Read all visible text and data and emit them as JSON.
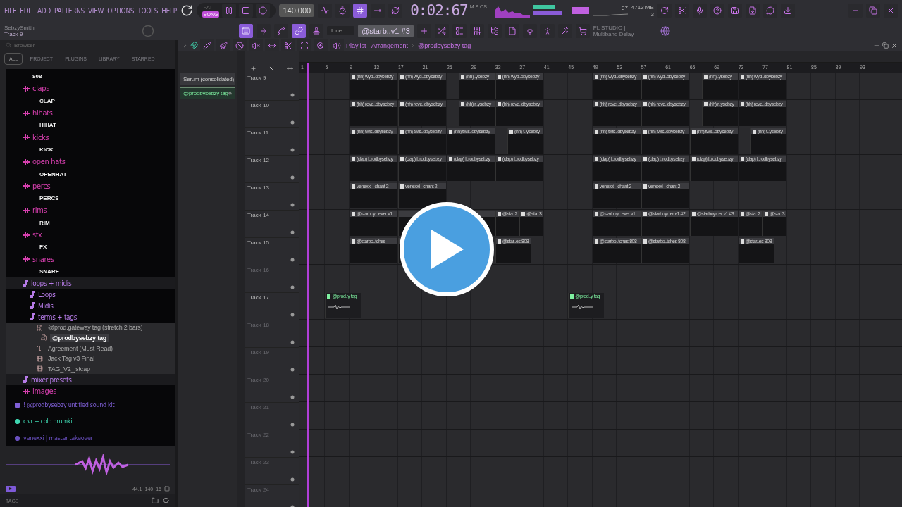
{
  "menu": [
    "FILE",
    "EDIT",
    "ADD",
    "PATTERNS",
    "VIEW",
    "OPTIONS",
    "TOOLS",
    "HELP"
  ],
  "transport": {
    "modes": [
      {
        "label": "PAT",
        "selected": false
      },
      {
        "label": "SONG",
        "selected": true
      }
    ],
    "tempo": "140.000",
    "time": "0:02:67",
    "time_format": "M:S:CS"
  },
  "toggles_top": [
    {
      "on": false
    },
    {
      "on": false
    },
    {
      "on": true
    },
    {
      "on": false
    },
    {
      "on": false
    }
  ],
  "monitor": {
    "cpu": "37",
    "memory": "4713 MB",
    "polyphony": "3"
  },
  "hint": {
    "title": "SebzySmith",
    "text": "Track 9"
  },
  "toggles_tools": [
    {
      "on": true
    },
    {
      "on": false
    },
    {
      "on": false
    },
    {
      "on": true
    },
    {
      "on": false
    }
  ],
  "snap": "Line",
  "pattern": "@starb..v1 #3",
  "news": {
    "title": "FL STUDIO |",
    "text": "Multiband Delay"
  },
  "browser": {
    "title": "Browser",
    "tabs": [
      {
        "label": "ALL",
        "selected": true
      },
      {
        "label": "PROJECT",
        "selected": false
      },
      {
        "label": "PLUGINS",
        "selected": false
      },
      {
        "label": "LIBRARY",
        "selected": false
      },
      {
        "label": "STARRED",
        "selected": false
      }
    ],
    "tree": [
      {
        "kind": "sample",
        "label": "808"
      },
      {
        "kind": "drums",
        "label": "claps",
        "color": "#d63fae",
        "children": [
          {
            "kind": "sample",
            "label": "CLAP"
          }
        ]
      },
      {
        "kind": "drums",
        "label": "hihats",
        "color": "#d63fae",
        "children": [
          {
            "kind": "sample",
            "label": "HIHAT"
          }
        ]
      },
      {
        "kind": "drums",
        "label": "kicks",
        "color": "#d63fae",
        "children": [
          {
            "kind": "sample",
            "label": "KICK"
          }
        ]
      },
      {
        "kind": "drums",
        "label": "open hats",
        "color": "#d63fae",
        "children": [
          {
            "kind": "sample",
            "label": "OPENHAT"
          }
        ]
      },
      {
        "kind": "drums",
        "label": "percs",
        "color": "#d63fae",
        "children": [
          {
            "kind": "sample",
            "label": "PERCS"
          }
        ]
      },
      {
        "kind": "drums",
        "label": "rims",
        "color": "#d63fae",
        "children": [
          {
            "kind": "sample",
            "label": "RIM"
          }
        ]
      },
      {
        "kind": "drums",
        "label": "sfx",
        "color": "#d63fae",
        "children": [
          {
            "kind": "sample",
            "label": "FX"
          }
        ]
      },
      {
        "kind": "drums",
        "label": "snares",
        "color": "#d63fae",
        "children": [
          {
            "kind": "sample",
            "label": "SNARE"
          }
        ]
      },
      {
        "kind": "music",
        "label": "loops + midis",
        "color": "#b57be6",
        "children": [
          {
            "kind": "music",
            "label": "Loops",
            "color": "#b57be6"
          },
          {
            "kind": "music",
            "label": "Midis",
            "color": "#b57be6"
          },
          {
            "kind": "music",
            "label": "terms + tags",
            "color": "#b57be6",
            "children": [
              {
                "kind": "audio",
                "label": "@prod.gateway tag (stretch 2 bars)",
                "selected": false
              },
              {
                "kind": "audio",
                "label": "@prodbysebzy tag",
                "selected": true
              },
              {
                "kind": "text",
                "label": "Agreement (Must Read)",
                "selected": false
              },
              {
                "kind": "video",
                "label": "Jack Tag v3 Final",
                "selected": false
              },
              {
                "kind": "video",
                "label": "TAG_V2_jstcap",
                "selected": false
              }
            ]
          }
        ]
      },
      {
        "kind": "music",
        "label": "mixer presets",
        "color": "#b57be6"
      },
      {
        "kind": "drums",
        "label": "images",
        "color": "#d63fae"
      }
    ],
    "roots": [
      {
        "kind": "star",
        "label": "! @prodbysebzy untitled sound kit",
        "color": "#7f5fd6"
      },
      {
        "kind": "speaker",
        "label": "clvr + cold drumkit",
        "color": "#3fd6b0"
      },
      {
        "kind": "link",
        "label": "venexxi | master takeover",
        "color": "#6a50c0"
      }
    ],
    "status": [
      "44.1",
      "140",
      "16"
    ],
    "footer": "TAGS"
  },
  "playlist": {
    "title": "Playlist - Arrangement",
    "pattern": "@prodbysebzy tag",
    "picker": [
      {
        "label": "Serum (consolidated)",
        "selected": false
      },
      {
        "label": "@prodbysebzy tag",
        "selected": true
      }
    ],
    "ruler": [
      "1",
      "5",
      "9",
      "13",
      "17",
      "21",
      "25",
      "29",
      "33",
      "37",
      "41",
      "45",
      "49",
      "53",
      "57",
      "61",
      "65",
      "69",
      "73",
      "77",
      "81",
      "85",
      "89",
      "93"
    ],
    "tracks": [
      {
        "label": "Track 9",
        "dimmed": false,
        "clips": [
          {
            "kind": "pattern",
            "label": "(hh) wyd..dbysebzy"
          },
          {
            "kind": "pattern",
            "label": "(hh) wyd..dbysebzy"
          },
          {
            "kind": "pattern",
            "label": "(hh)..ysebzy"
          },
          {
            "kind": "pattern",
            "label": "(hh) wyd..dbysebzy"
          },
          {
            "kind": "pattern",
            "label": "(hh) wyd..dbysebzy"
          },
          {
            "kind": "pattern",
            "label": "(hh) wyd..dbysebzy"
          },
          {
            "kind": "pattern",
            "label": "(hh)..ysebzy"
          },
          {
            "kind": "pattern",
            "label": "(hh) wyd..dbysebzy"
          }
        ]
      },
      {
        "label": "Track 10",
        "dimmed": false,
        "clips": [
          {
            "kind": "pattern",
            "label": "(hh) reve..dbysebzy"
          },
          {
            "kind": "pattern",
            "label": "(hh) reve..dbysebzy"
          },
          {
            "kind": "pattern",
            "label": "(hh) r..ysebzy"
          },
          {
            "kind": "pattern",
            "label": "(hh) reve..dbysebzy"
          },
          {
            "kind": "pattern",
            "label": "(hh) reve..dbysebzy"
          },
          {
            "kind": "pattern",
            "label": "(hh) reve..dbysebzy"
          },
          {
            "kind": "pattern",
            "label": "(hh) r..ysebzy"
          },
          {
            "kind": "pattern",
            "label": "(hh) reve..dbysebzy"
          }
        ]
      },
      {
        "label": "Track 11",
        "dimmed": false,
        "clips": [
          {
            "kind": "pattern",
            "label": "(hh) twis..dbysebzy"
          },
          {
            "kind": "pattern",
            "label": "(hh) twis..dbysebzy"
          },
          {
            "kind": "pattern",
            "label": "(hh) twis..dbysebzy"
          },
          {
            "kind": "pattern",
            "label": "(hh) t..ysebzy"
          },
          {
            "kind": "pattern",
            "label": "(hh) twis..dbysebzy"
          },
          {
            "kind": "pattern",
            "label": "(hh) twis..dbysebzy"
          },
          {
            "kind": "pattern",
            "label": "(hh) twis..dbysebzy"
          },
          {
            "kind": "pattern",
            "label": "(hh) t..ysebzy"
          }
        ]
      },
      {
        "label": "Track 12",
        "dimmed": false,
        "clips": [
          {
            "kind": "pattern",
            "label": "(clap) l..rodbysebzy"
          },
          {
            "kind": "pattern",
            "label": "(clap) l..rodbysebzy"
          },
          {
            "kind": "pattern",
            "label": "(clap) l..rodbysebzy"
          },
          {
            "kind": "pattern",
            "label": "(clap) l..rodbysebzy"
          },
          {
            "kind": "pattern",
            "label": "(clap) l..rodbysebzy"
          },
          {
            "kind": "pattern",
            "label": "(clap) l..rodbysebzy"
          },
          {
            "kind": "pattern",
            "label": "(clap) l..rodbysebzy"
          },
          {
            "kind": "pattern",
            "label": "(clap) l..rodbysebzy"
          }
        ]
      },
      {
        "label": "Track 13",
        "dimmed": false,
        "clips": [
          {
            "kind": "pattern",
            "label": "venexxi - chant 2"
          },
          {
            "kind": "pattern",
            "label": "venexxi - chant 2"
          },
          {
            "kind": "pattern",
            "label": "venexxi - chant 2"
          },
          {
            "kind": "pattern",
            "label": "venexxi - chant 2"
          }
        ]
      },
      {
        "label": "Track 14",
        "dimmed": false,
        "clips": [
          {
            "kind": "pattern",
            "label": "@starboyr..ever v1"
          },
          {
            "kind": "pattern"
          },
          {
            "kind": "pattern"
          },
          {
            "kind": "pattern",
            "label": "@sta..2"
          },
          {
            "kind": "pattern",
            "label": "@sta..3"
          },
          {
            "kind": "pattern",
            "label": "@starboyr..ever v1"
          },
          {
            "kind": "pattern",
            "label": "@starboyr..er v1 #2"
          },
          {
            "kind": "pattern",
            "label": "@starboyr..er v1 #3"
          },
          {
            "kind": "pattern",
            "label": "@sta..2"
          },
          {
            "kind": "pattern",
            "label": "@sta..3"
          }
        ]
      },
      {
        "label": "Track 15",
        "dimmed": false,
        "clips": [
          {
            "kind": "pattern",
            "label": "@starbo..tches"
          },
          {
            "kind": "pattern"
          },
          {
            "kind": "pattern",
            "label": "@star..es 808"
          },
          {
            "kind": "pattern",
            "label": "@starbo..tches 808"
          },
          {
            "kind": "pattern",
            "label": "@starbo..tches 808"
          },
          {
            "kind": "pattern",
            "label": "@star..es 808"
          }
        ]
      },
      {
        "label": "Track 16",
        "dimmed": true
      },
      {
        "label": "Track 17",
        "dimmed": false,
        "clips": [
          {
            "kind": "audio",
            "label": "@prod..y tag"
          },
          {
            "kind": "audio",
            "label": "@prod..y tag"
          }
        ]
      },
      {
        "label": "Track 18",
        "dimmed": true
      },
      {
        "label": "Track 19",
        "dimmed": true
      },
      {
        "label": "Track 20",
        "dimmed": true
      },
      {
        "label": "Track 21",
        "dimmed": true
      },
      {
        "label": "Track 22",
        "dimmed": true
      },
      {
        "label": "Track 23",
        "dimmed": true
      },
      {
        "label": "Track 24",
        "dimmed": true
      }
    ]
  }
}
